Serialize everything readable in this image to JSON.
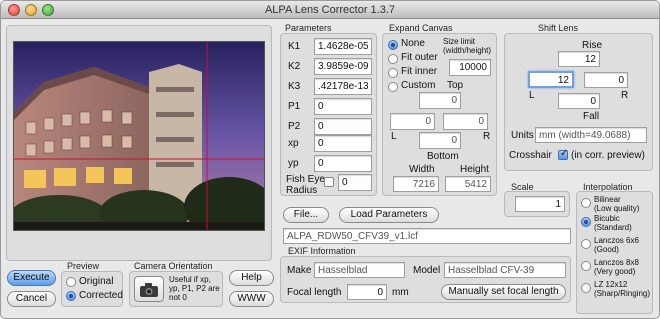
{
  "window": {
    "title": "ALPA Lens Corrector 1.3.7"
  },
  "parameters": {
    "heading": "Parameters",
    "k1": {
      "label": "K1",
      "value": "1.4628e-05"
    },
    "k2": {
      "label": "K2",
      "value": "3.9859e-09"
    },
    "k3": {
      "label": "K3",
      "value": ".42178e-13"
    },
    "p1": {
      "label": "P1",
      "value": "0"
    },
    "p2": {
      "label": "P2",
      "value": "0"
    },
    "xp": {
      "label": "xp",
      "value": "0"
    },
    "yp": {
      "label": "yp",
      "value": "0"
    },
    "fisheye": {
      "label_line1": "Fish Eye",
      "label_line2": "Radius",
      "value": "0",
      "checked": false
    }
  },
  "expand_canvas": {
    "heading": "Expand Canvas",
    "options": [
      {
        "label": "None",
        "selected": true
      },
      {
        "label": "Fit outer",
        "selected": false
      },
      {
        "label": "Fit inner",
        "selected": false
      },
      {
        "label": "Custom",
        "selected": false
      }
    ],
    "size_limit_label_line1": "Size limit",
    "size_limit_label_line2": "(width/height)",
    "size_limit_value": "10000",
    "top_label": "Top",
    "top_value": "0",
    "left_label": "L",
    "left_value": "0",
    "right_label": "R",
    "right_value": "0",
    "bottom_value": "0",
    "bottom_label": "Bottom",
    "width_label": "Width",
    "height_label": "Height",
    "width_value": "7216",
    "height_value": "5412"
  },
  "shift_lens": {
    "heading": "Shift Lens",
    "rise_label": "Rise",
    "rise_value": "12",
    "left_value": "12",
    "right_value": "0",
    "left_label": "L",
    "right_label": "R",
    "fall_value": "0",
    "fall_label": "Fall",
    "units_label": "Units",
    "units_value": "mm  (width=49.0688)",
    "crosshair_label": "Crosshair",
    "crosshair_checkbox_label": "(in corr. preview)",
    "crosshair_checked": true
  },
  "scale": {
    "heading": "Scale",
    "value": "1"
  },
  "interpolation": {
    "heading": "Interpolation",
    "options": [
      {
        "line1": "Bilinear",
        "line2": "(Low quality)",
        "selected": false
      },
      {
        "line1": "Bicubic",
        "line2": "(Standard)",
        "selected": true
      },
      {
        "line1": "Lanczos 6x6",
        "line2": "(Good)",
        "selected": false
      },
      {
        "line1": "Lanczos 8x8",
        "line2": "(Very good)",
        "selected": false
      },
      {
        "line1": "LZ 12x12",
        "line2": "(Sharp/Ringing)",
        "selected": false
      }
    ]
  },
  "file": {
    "file_button": "File...",
    "load_button": "Load Parameters",
    "filename": "ALPA_RDW50_CFV39_v1.lcf"
  },
  "exif": {
    "heading": "EXIF Information",
    "make_label": "Make",
    "make_value": "Hasselblad",
    "model_label": "Model",
    "model_value": "Hasselblad CFV-39",
    "focal_label": "Focal length",
    "focal_value": "0",
    "focal_unit": "mm",
    "manual_button": "Manually set focal length"
  },
  "actions": {
    "execute": "Execute",
    "cancel": "Cancel",
    "help": "Help",
    "www": "WWW"
  },
  "preview": {
    "heading": "Preview",
    "options": [
      {
        "label": "Original",
        "selected": false
      },
      {
        "label": "Corrected",
        "selected": true
      }
    ]
  },
  "camera_orientation": {
    "heading": "Camera Orientation",
    "icon": "camera-icon",
    "note": "Useful if xp, yp, P1, P2 are not 0"
  },
  "colors": {
    "crosshair": "#c8102e",
    "accent": "#5d9ee8"
  }
}
